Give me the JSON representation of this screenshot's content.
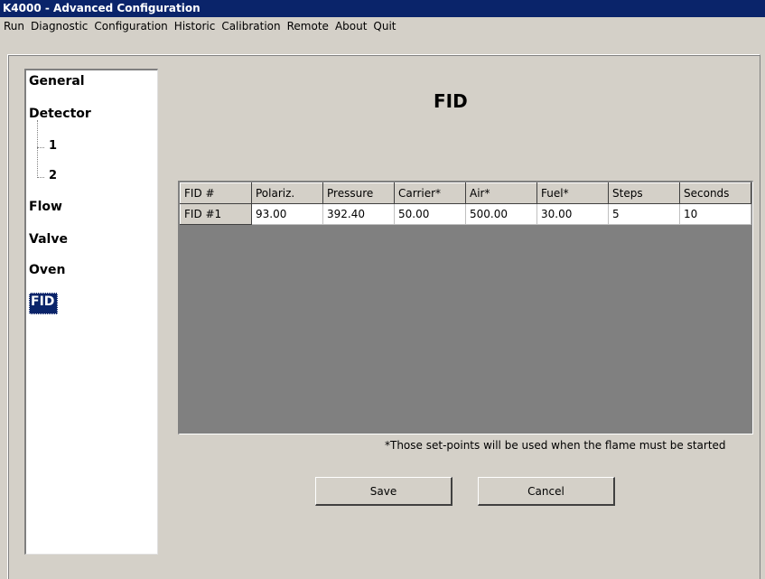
{
  "window": {
    "title": "K4000 - Advanced Configuration"
  },
  "menu": [
    "Run",
    "Diagnostic",
    "Configuration",
    "Historic",
    "Calibration",
    "Remote",
    "About",
    "Quit"
  ],
  "tree": {
    "items": [
      "General",
      "Detector",
      "Flow",
      "Valve",
      "Oven",
      "FID"
    ],
    "detector_children": [
      "1",
      "2"
    ],
    "selected": "FID"
  },
  "section_title": "FID",
  "table": {
    "headers": [
      "FID #",
      "Polariz.",
      "Pressure",
      "Carrier*",
      "Air*",
      "Fuel*",
      "Steps",
      "Seconds"
    ],
    "rows": [
      [
        "FID #1",
        "93.00",
        "392.40",
        "50.00",
        "500.00",
        "30.00",
        "5",
        "10"
      ]
    ]
  },
  "note": "*Those set-points will be used when the flame must be started",
  "buttons": {
    "save": "Save",
    "cancel": "Cancel"
  }
}
